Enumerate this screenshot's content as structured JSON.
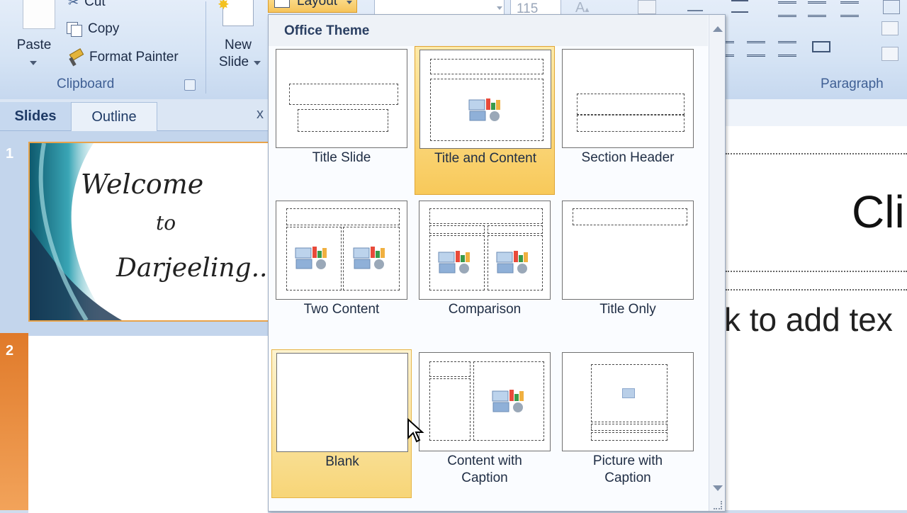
{
  "ribbon": {
    "clipboard": {
      "paste_label": "Paste",
      "cut_label": "Cut",
      "copy_label": "Copy",
      "format_painter_label": "Format Painter",
      "group_label": "Clipboard"
    },
    "slides": {
      "new_slide_label_1": "New",
      "new_slide_label_2": "Slide",
      "layout_label": "Layout"
    },
    "font": {
      "size_value": "115"
    },
    "paragraph": {
      "group_label": "Paragraph"
    }
  },
  "panel": {
    "tabs": [
      {
        "label": "Slides"
      },
      {
        "label": "Outline"
      }
    ],
    "close_glyph": "x",
    "slides": [
      {
        "number": "1",
        "line1": "Welcome",
        "line2": "to",
        "line3": "Darjeeling..."
      },
      {
        "number": "2"
      }
    ]
  },
  "gallery": {
    "title": "Office Theme",
    "layouts": [
      {
        "label": "Title Slide",
        "state": "normal"
      },
      {
        "label": "Title and Content",
        "state": "selected"
      },
      {
        "label": "Section Header",
        "state": "normal"
      },
      {
        "label": "Two Content",
        "state": "normal"
      },
      {
        "label": "Comparison",
        "state": "normal"
      },
      {
        "label": "Title Only",
        "state": "normal"
      },
      {
        "label": "Blank",
        "state": "hover"
      },
      {
        "label": "Content with Caption",
        "label_line1": "Content with",
        "label_line2": "Caption",
        "state": "normal"
      },
      {
        "label": "Picture with Caption",
        "label_line1": "Picture with",
        "label_line2": "Caption",
        "state": "normal"
      }
    ]
  },
  "slide_canvas": {
    "title_text": "Cli",
    "body_text": "k to add tex"
  },
  "colors": {
    "selection": "#f8c95a",
    "ribbon_text": "#3f5f94",
    "slide_panel": "#c3d5ec"
  }
}
